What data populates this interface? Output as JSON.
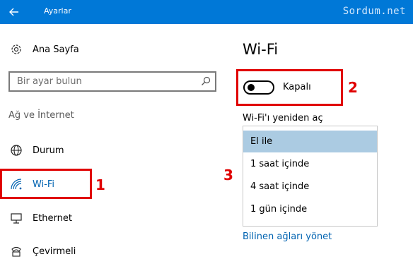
{
  "titlebar": {
    "title": "Ayarlar",
    "watermark": "Sordum.net"
  },
  "sidebar": {
    "home_label": "Ana Sayfa",
    "search_placeholder": "Bir ayar bulun",
    "section_title": "Ağ ve İnternet",
    "items": [
      {
        "label": "Durum",
        "icon": "globe-icon",
        "active": false
      },
      {
        "label": "Wi-Fi",
        "icon": "wifi-icon",
        "active": true
      },
      {
        "label": "Ethernet",
        "icon": "ethernet-icon",
        "active": false
      },
      {
        "label": "Çevirmeli",
        "icon": "dialup-icon",
        "active": false
      }
    ]
  },
  "main": {
    "heading": "Wi-Fi",
    "toggle": {
      "label": "Kapalı",
      "state": "off"
    },
    "turn_on_label": "Wi-Fi'ı yeniden aç",
    "options": [
      {
        "label": "El ile",
        "selected": true
      },
      {
        "label": "1 saat içinde",
        "selected": false
      },
      {
        "label": "4 saat içinde",
        "selected": false
      },
      {
        "label": "1 gün içinde",
        "selected": false
      }
    ],
    "link": "Bilinen ağları yönet"
  },
  "annotations": {
    "n1": "1",
    "n2": "2",
    "n3": "3"
  },
  "colors": {
    "accent": "#0078d7",
    "link": "#0063b1",
    "highlight": "#abcbe2",
    "annotation": "#e00000"
  }
}
